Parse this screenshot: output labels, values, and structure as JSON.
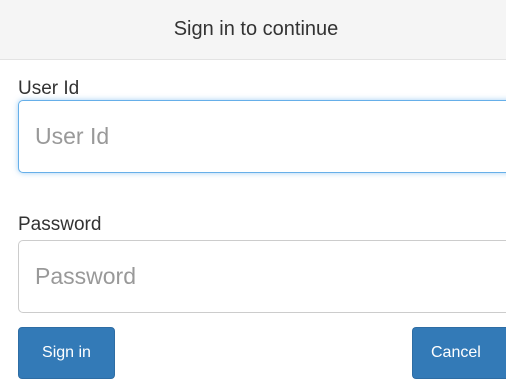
{
  "header": {
    "title": "Sign in to continue"
  },
  "form": {
    "userid": {
      "label": "User Id",
      "value": "",
      "placeholder": "User Id"
    },
    "password": {
      "label": "Password",
      "value": "",
      "placeholder": "Password"
    }
  },
  "actions": {
    "signin_label": "Sign in",
    "cancel_label": "Cancel"
  },
  "colors": {
    "primary_button": "#337ab7",
    "focus_border": "#66afe9",
    "header_background": "#f5f5f5"
  }
}
